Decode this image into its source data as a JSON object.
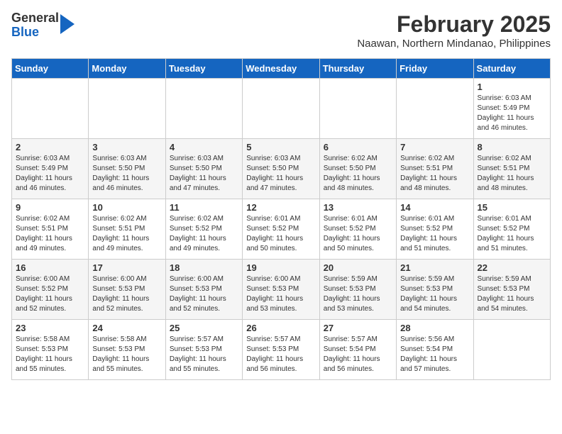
{
  "logo": {
    "general": "General",
    "blue": "Blue"
  },
  "title": "February 2025",
  "subtitle": "Naawan, Northern Mindanao, Philippines",
  "days_header": [
    "Sunday",
    "Monday",
    "Tuesday",
    "Wednesday",
    "Thursday",
    "Friday",
    "Saturday"
  ],
  "weeks": [
    [
      {
        "day": "",
        "info": ""
      },
      {
        "day": "",
        "info": ""
      },
      {
        "day": "",
        "info": ""
      },
      {
        "day": "",
        "info": ""
      },
      {
        "day": "",
        "info": ""
      },
      {
        "day": "",
        "info": ""
      },
      {
        "day": "1",
        "info": "Sunrise: 6:03 AM\nSunset: 5:49 PM\nDaylight: 11 hours and 46 minutes."
      }
    ],
    [
      {
        "day": "2",
        "info": "Sunrise: 6:03 AM\nSunset: 5:49 PM\nDaylight: 11 hours and 46 minutes."
      },
      {
        "day": "3",
        "info": "Sunrise: 6:03 AM\nSunset: 5:50 PM\nDaylight: 11 hours and 46 minutes."
      },
      {
        "day": "4",
        "info": "Sunrise: 6:03 AM\nSunset: 5:50 PM\nDaylight: 11 hours and 47 minutes."
      },
      {
        "day": "5",
        "info": "Sunrise: 6:03 AM\nSunset: 5:50 PM\nDaylight: 11 hours and 47 minutes."
      },
      {
        "day": "6",
        "info": "Sunrise: 6:02 AM\nSunset: 5:50 PM\nDaylight: 11 hours and 48 minutes."
      },
      {
        "day": "7",
        "info": "Sunrise: 6:02 AM\nSunset: 5:51 PM\nDaylight: 11 hours and 48 minutes."
      },
      {
        "day": "8",
        "info": "Sunrise: 6:02 AM\nSunset: 5:51 PM\nDaylight: 11 hours and 48 minutes."
      }
    ],
    [
      {
        "day": "9",
        "info": "Sunrise: 6:02 AM\nSunset: 5:51 PM\nDaylight: 11 hours and 49 minutes."
      },
      {
        "day": "10",
        "info": "Sunrise: 6:02 AM\nSunset: 5:51 PM\nDaylight: 11 hours and 49 minutes."
      },
      {
        "day": "11",
        "info": "Sunrise: 6:02 AM\nSunset: 5:52 PM\nDaylight: 11 hours and 49 minutes."
      },
      {
        "day": "12",
        "info": "Sunrise: 6:01 AM\nSunset: 5:52 PM\nDaylight: 11 hours and 50 minutes."
      },
      {
        "day": "13",
        "info": "Sunrise: 6:01 AM\nSunset: 5:52 PM\nDaylight: 11 hours and 50 minutes."
      },
      {
        "day": "14",
        "info": "Sunrise: 6:01 AM\nSunset: 5:52 PM\nDaylight: 11 hours and 51 minutes."
      },
      {
        "day": "15",
        "info": "Sunrise: 6:01 AM\nSunset: 5:52 PM\nDaylight: 11 hours and 51 minutes."
      }
    ],
    [
      {
        "day": "16",
        "info": "Sunrise: 6:00 AM\nSunset: 5:52 PM\nDaylight: 11 hours and 52 minutes."
      },
      {
        "day": "17",
        "info": "Sunrise: 6:00 AM\nSunset: 5:53 PM\nDaylight: 11 hours and 52 minutes."
      },
      {
        "day": "18",
        "info": "Sunrise: 6:00 AM\nSunset: 5:53 PM\nDaylight: 11 hours and 52 minutes."
      },
      {
        "day": "19",
        "info": "Sunrise: 6:00 AM\nSunset: 5:53 PM\nDaylight: 11 hours and 53 minutes."
      },
      {
        "day": "20",
        "info": "Sunrise: 5:59 AM\nSunset: 5:53 PM\nDaylight: 11 hours and 53 minutes."
      },
      {
        "day": "21",
        "info": "Sunrise: 5:59 AM\nSunset: 5:53 PM\nDaylight: 11 hours and 54 minutes."
      },
      {
        "day": "22",
        "info": "Sunrise: 5:59 AM\nSunset: 5:53 PM\nDaylight: 11 hours and 54 minutes."
      }
    ],
    [
      {
        "day": "23",
        "info": "Sunrise: 5:58 AM\nSunset: 5:53 PM\nDaylight: 11 hours and 55 minutes."
      },
      {
        "day": "24",
        "info": "Sunrise: 5:58 AM\nSunset: 5:53 PM\nDaylight: 11 hours and 55 minutes."
      },
      {
        "day": "25",
        "info": "Sunrise: 5:57 AM\nSunset: 5:53 PM\nDaylight: 11 hours and 55 minutes."
      },
      {
        "day": "26",
        "info": "Sunrise: 5:57 AM\nSunset: 5:53 PM\nDaylight: 11 hours and 56 minutes."
      },
      {
        "day": "27",
        "info": "Sunrise: 5:57 AM\nSunset: 5:54 PM\nDaylight: 11 hours and 56 minutes."
      },
      {
        "day": "28",
        "info": "Sunrise: 5:56 AM\nSunset: 5:54 PM\nDaylight: 11 hours and 57 minutes."
      },
      {
        "day": "",
        "info": ""
      }
    ]
  ]
}
